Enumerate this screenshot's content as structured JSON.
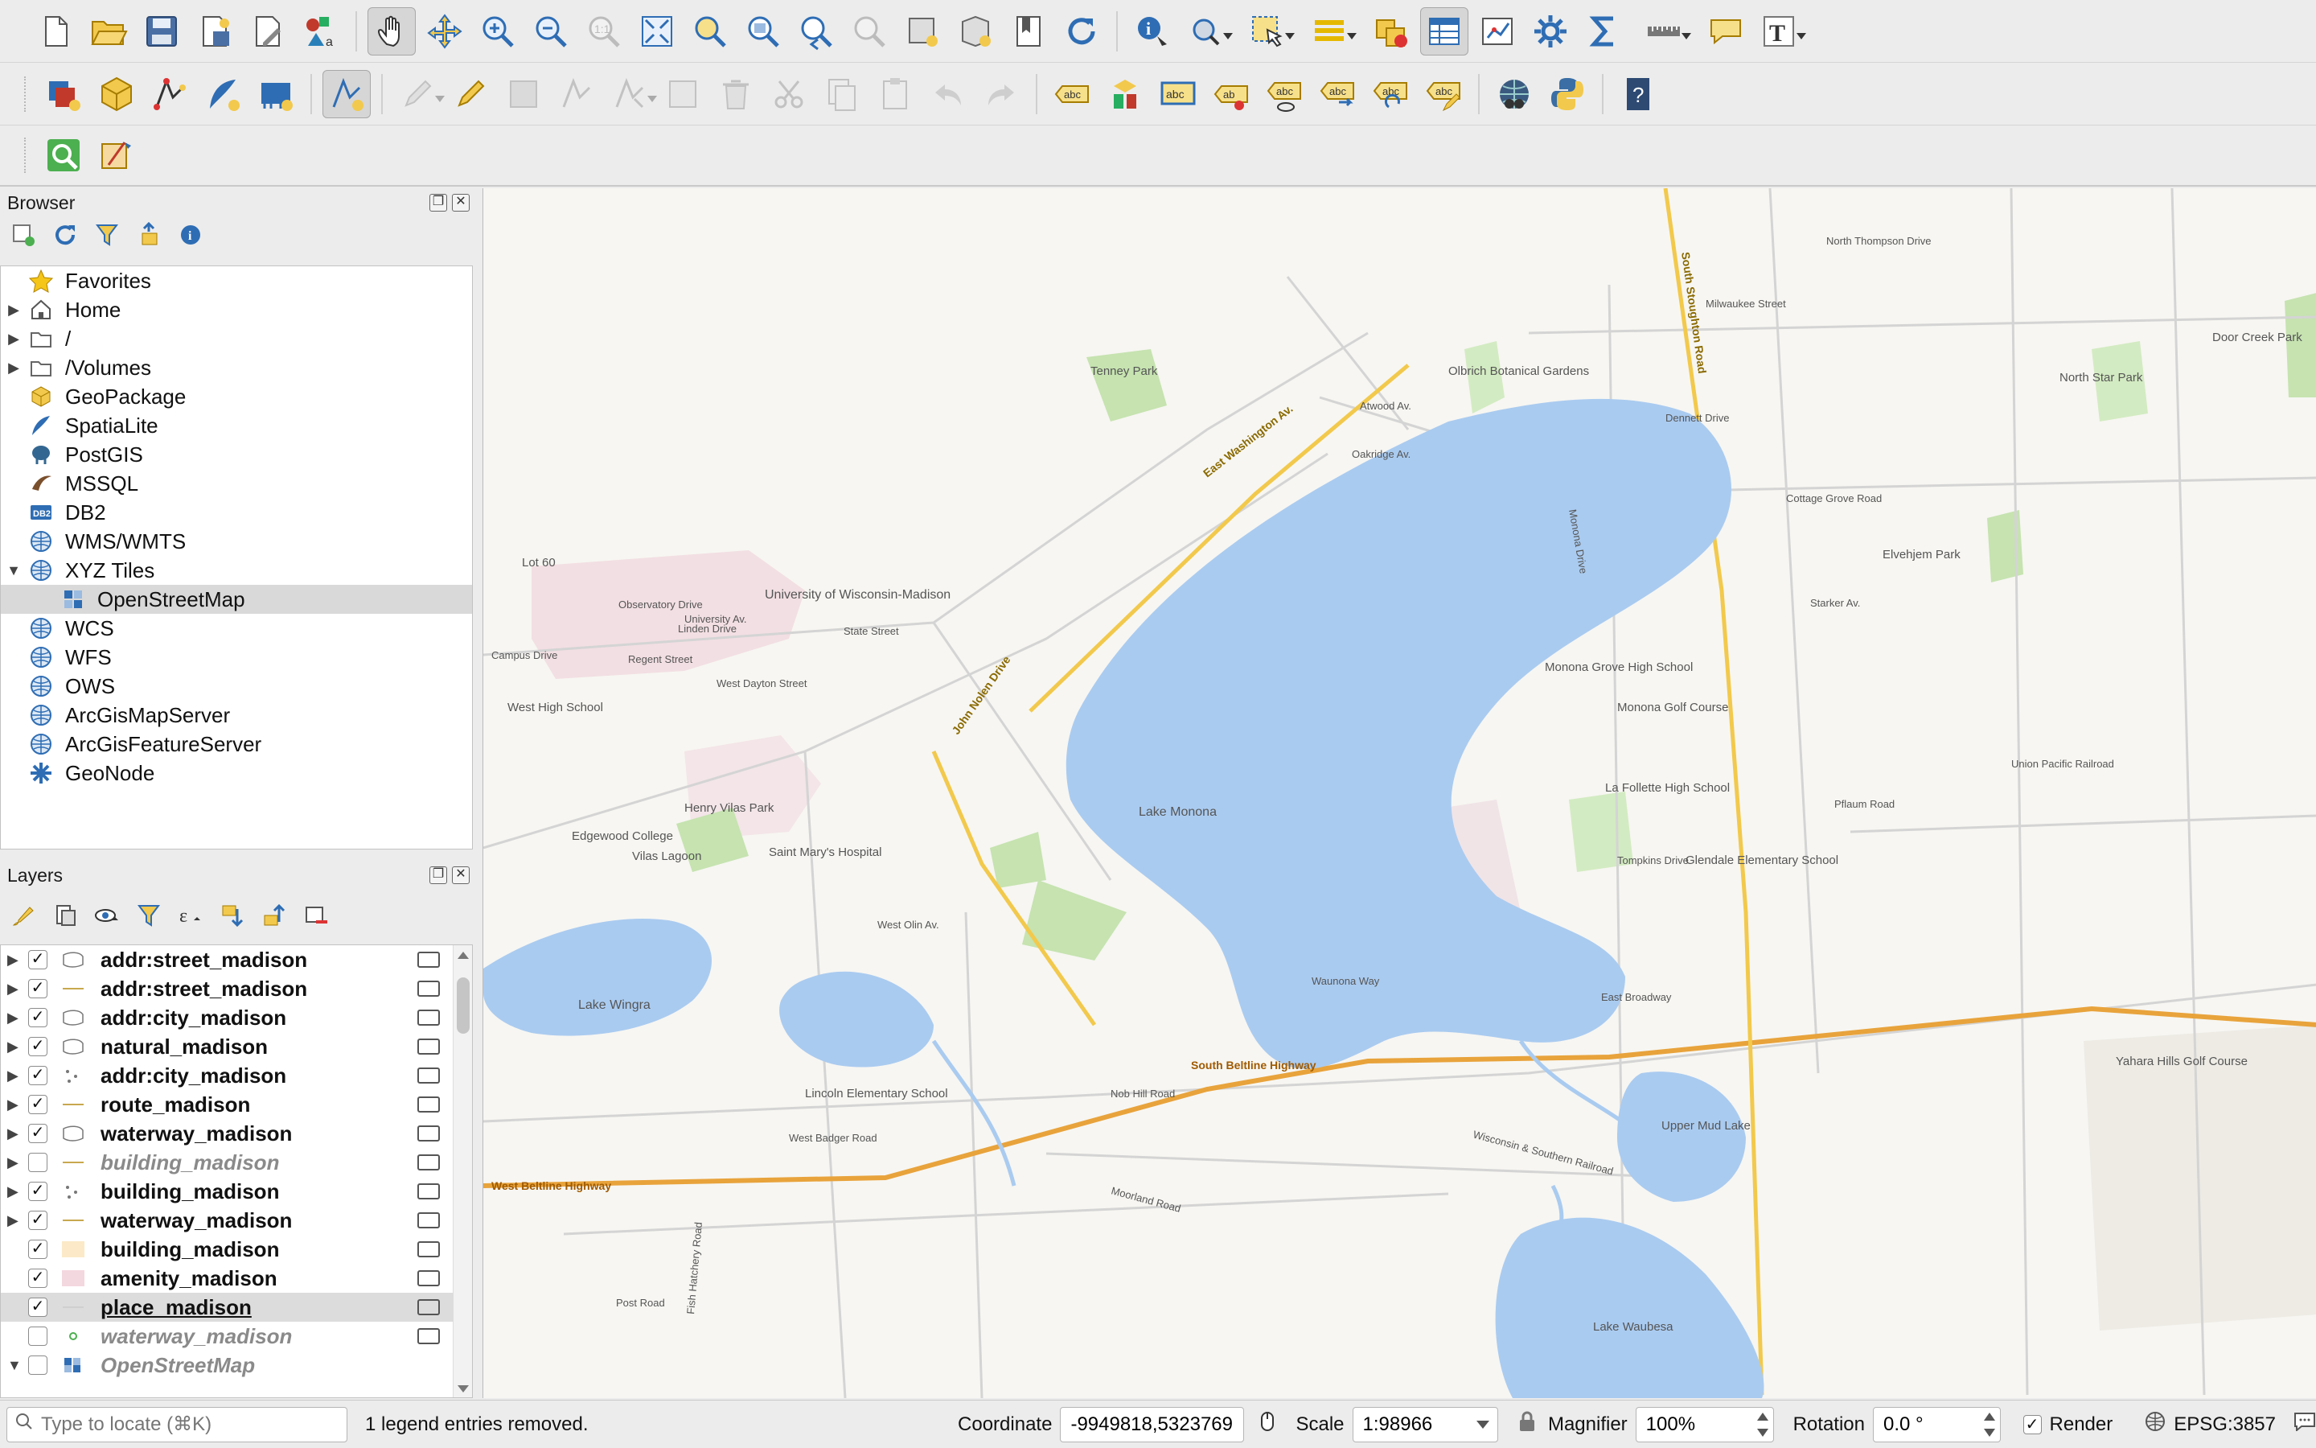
{
  "panels": {
    "browser_title": "Browser",
    "layers_title": "Layers"
  },
  "browser_items": [
    {
      "label": "Favorites",
      "icon": "star-icon"
    },
    {
      "label": "Home",
      "icon": "home-icon"
    },
    {
      "label": "/",
      "icon": "folder-icon"
    },
    {
      "label": "/Volumes",
      "icon": "folder-icon"
    },
    {
      "label": "GeoPackage",
      "icon": "geopackage-icon"
    },
    {
      "label": "SpatiaLite",
      "icon": "spatialite-icon"
    },
    {
      "label": "PostGIS",
      "icon": "postgis-icon"
    },
    {
      "label": "MSSQL",
      "icon": "mssql-icon"
    },
    {
      "label": "DB2",
      "icon": "db2-icon"
    },
    {
      "label": "WMS/WMTS",
      "icon": "globe-icon"
    },
    {
      "label": "XYZ Tiles",
      "icon": "globe-icon"
    },
    {
      "label": "OpenStreetMap",
      "icon": "xyz-tile-icon"
    },
    {
      "label": "WCS",
      "icon": "globe-icon"
    },
    {
      "label": "WFS",
      "icon": "globe-icon"
    },
    {
      "label": "OWS",
      "icon": "globe-icon"
    },
    {
      "label": "ArcGisMapServer",
      "icon": "globe-icon"
    },
    {
      "label": "ArcGisFeatureServer",
      "icon": "globe-icon"
    },
    {
      "label": "GeoNode",
      "icon": "geonode-icon"
    }
  ],
  "db2_badge": "DB2",
  "layers": [
    {
      "name": "addr:street_madison",
      "checked": true,
      "type": "polygon"
    },
    {
      "name": "addr:street_madison",
      "checked": true,
      "type": "line"
    },
    {
      "name": "addr:city_madison",
      "checked": true,
      "type": "polygon"
    },
    {
      "name": "natural_madison",
      "checked": true,
      "type": "polygon"
    },
    {
      "name": "addr:city_madison",
      "checked": true,
      "type": "point"
    },
    {
      "name": "route_madison",
      "checked": true,
      "type": "line"
    },
    {
      "name": "waterway_madison",
      "checked": true,
      "type": "polygon"
    },
    {
      "name": "building_madison",
      "checked": false,
      "type": "line"
    },
    {
      "name": "building_madison",
      "checked": true,
      "type": "point"
    },
    {
      "name": "waterway_madison",
      "checked": true,
      "type": "line"
    },
    {
      "name": "building_madison",
      "checked": true,
      "type": "fill-yellow"
    },
    {
      "name": "amenity_madison",
      "checked": true,
      "type": "fill-pink"
    },
    {
      "name": "place_madison",
      "checked": true,
      "type": "line-gray"
    },
    {
      "name": "waterway_madison",
      "checked": false,
      "type": "point-green"
    },
    {
      "name": "OpenStreetMap",
      "checked": false,
      "type": "raster"
    }
  ],
  "status": {
    "locate_placeholder": "Type to locate (⌘K)",
    "message": "1 legend entries removed.",
    "coordinate_label": "Coordinate",
    "coordinate_value": "-9949818,5323769",
    "scale_label": "Scale",
    "scale_value": "1:98966",
    "magnifier_label": "Magnifier",
    "magnifier_value": "100%",
    "rotation_label": "Rotation",
    "rotation_value": "0.0 °",
    "render_label": "Render",
    "crs": "EPSG:3857"
  },
  "map": {
    "lake_labels": [
      "Lake Monona",
      "Lake Wingra",
      "Upper Mud Lake",
      "Lake Waubesa"
    ],
    "place_labels": [
      "University of Wisconsin-Madison",
      "Lot 60",
      "West High School",
      "Henry Vilas Park",
      "Vilas Lagoon",
      "Saint Mary's Hospital",
      "Edgewood College",
      "Tenney Park",
      "Olbrich Botanical Gardens",
      "Monona Grove High School",
      "Monona Golf Course",
      "La Follette High School",
      "Glendale Elementary School",
      "Lincoln Elementary School",
      "Elvehjem Park",
      "North Star Park",
      "Door Creek Park",
      "Yahara Hills Golf Course"
    ],
    "road_labels": [
      "South Beltline Highway",
      "West Beltline Highway",
      "East Washington Av.",
      "John Nolen Drive",
      "South Stoughton Road",
      "Cottage Grove Road",
      "Milwaukee Street",
      "East Broadway",
      "Pflaum Road",
      "Union Pacific Railroad",
      "Monona Drive",
      "Regent Street",
      "University Av.",
      "Campus Drive",
      "Starker Av.",
      "Dennett Drive",
      "North Thompson Drive",
      "Wisconsin & Southern Railroad",
      "Moorland Road",
      "Nob Hill Road",
      "West Badger Road",
      "Atwood Av.",
      "Oakridge Av.",
      "West Olin Av.",
      "Waunona Way",
      "Tompkins Drive",
      "West Dayton Street",
      "State Street",
      "Linden Drive",
      "Observatory Drive",
      "Fish Hatchery Road",
      "Post Road"
    ]
  }
}
